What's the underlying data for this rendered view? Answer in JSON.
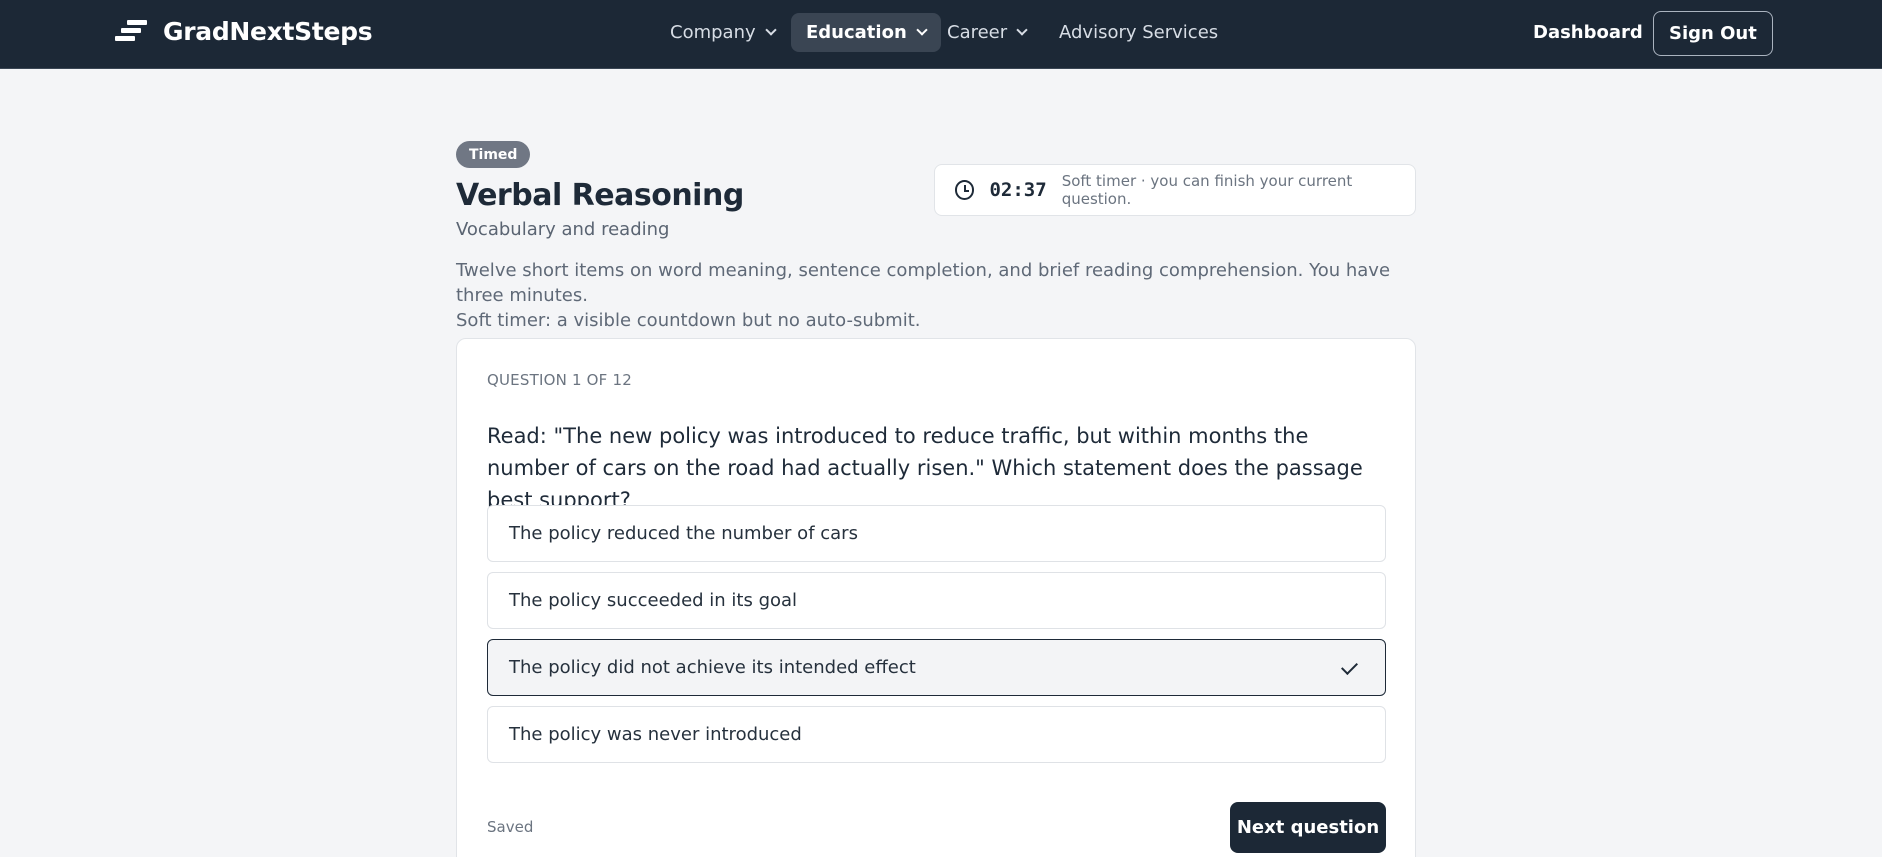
{
  "nav": {
    "brand": "GradNextSteps",
    "items": [
      {
        "label": "Company"
      },
      {
        "label": "Education"
      },
      {
        "label": "Career"
      },
      {
        "label": "Advisory Services"
      }
    ],
    "active_item": "Education",
    "dashboard_label": "Dashboard",
    "signout_label": "Sign Out"
  },
  "header": {
    "badge": "Timed",
    "title": "Verbal Reasoning",
    "subtitle": "Vocabulary and reading",
    "description_line1": "Twelve short items on word meaning, sentence completion, and brief reading comprehension. You have three minutes.",
    "description_line2": "Soft timer: a visible countdown but no auto-submit."
  },
  "timer": {
    "value": "02:37",
    "note": "Soft timer · you can finish your current question."
  },
  "question": {
    "counter": "QUESTION 1 OF 12",
    "text": "Read: \"The new policy was introduced to reduce traffic, but within months the number of cars on the road had actually risen.\" Which statement does the passage best support?",
    "options": [
      {
        "label": "The policy reduced the number of cars"
      },
      {
        "label": "The policy succeeded in its goal"
      },
      {
        "label": "The policy did not achieve its intended effect"
      },
      {
        "label": "The policy was never introduced"
      }
    ],
    "selected_index": 2
  },
  "footer": {
    "status": "Saved",
    "next_label": "Next question"
  },
  "colors": {
    "navbar": "#1c2836",
    "background": "#f4f5f7",
    "badge": "#707784",
    "primary_button": "#1c2836"
  }
}
